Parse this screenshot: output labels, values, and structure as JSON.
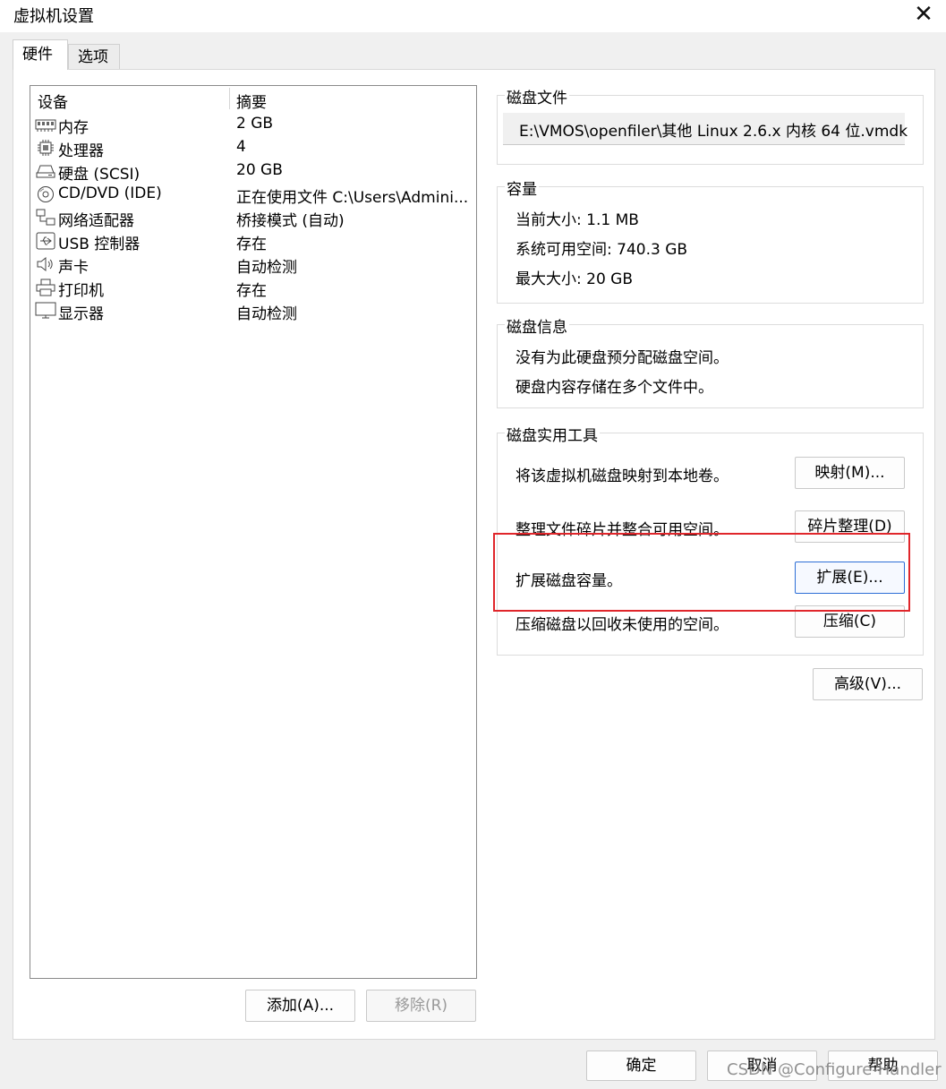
{
  "window": {
    "title": "虚拟机设置",
    "close_glyph": "✕"
  },
  "tabs": [
    {
      "label": "硬件"
    },
    {
      "label": "选项"
    }
  ],
  "device_list": {
    "headers": {
      "device": "设备",
      "summary": "摘要"
    },
    "rows": [
      {
        "icon": "memory-icon",
        "name": "内存",
        "summary": "2 GB"
      },
      {
        "icon": "processor-icon",
        "name": "处理器",
        "summary": "4"
      },
      {
        "icon": "hard-disk-icon",
        "name": "硬盘 (SCSI)",
        "summary": "20 GB"
      },
      {
        "icon": "cd-dvd-icon",
        "name": "CD/DVD (IDE)",
        "summary": "正在使用文件 C:\\Users\\Admini..."
      },
      {
        "icon": "network-adapter-icon",
        "name": "网络适配器",
        "summary": "桥接模式 (自动)"
      },
      {
        "icon": "usb-icon",
        "name": "USB 控制器",
        "summary": "存在"
      },
      {
        "icon": "sound-card-icon",
        "name": "声卡",
        "summary": "自动检测"
      },
      {
        "icon": "printer-icon",
        "name": "打印机",
        "summary": "存在"
      },
      {
        "icon": "display-icon",
        "name": "显示器",
        "summary": "自动检测"
      }
    ],
    "add_label": "添加(A)...",
    "remove_label": "移除(R)"
  },
  "disk_file": {
    "title": "磁盘文件",
    "path": "E:\\VMOS\\openfiler\\其他 Linux 2.6.x 内核 64 位.vmdk"
  },
  "capacity": {
    "title": "容量",
    "current_size": "当前大小: 1.1 MB",
    "available_space": "系统可用空间: 740.3 GB",
    "max_size": "最大大小: 20 GB"
  },
  "disk_info": {
    "title": "磁盘信息",
    "line1": "没有为此硬盘预分配磁盘空间。",
    "line2": "硬盘内容存储在多个文件中。"
  },
  "disk_utilities": {
    "title": "磁盘实用工具",
    "map_text": "将该虚拟机磁盘映射到本地卷。",
    "map_button": "映射(M)...",
    "defrag_text": "整理文件碎片并整合可用空间。",
    "defrag_button": "碎片整理(D)",
    "expand_text": "扩展磁盘容量。",
    "expand_button": "扩展(E)...",
    "compact_text": "压缩磁盘以回收未使用的空间。",
    "compact_button": "压缩(C)"
  },
  "advanced_button": "高级(V)...",
  "footer": {
    "ok": "确定",
    "cancel": "取消",
    "help": "帮助"
  },
  "watermark": "CSDN @Configure-Handler",
  "colors": {
    "highlight_box": "#e0262b",
    "focus_border": "#2d6ed6"
  }
}
